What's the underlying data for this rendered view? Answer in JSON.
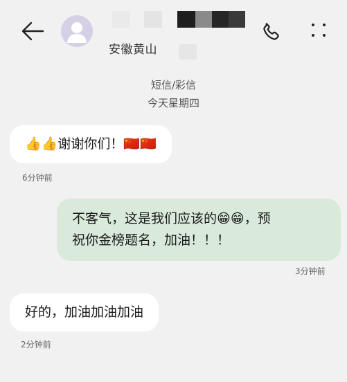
{
  "header": {
    "contact_name": "安徽黄山",
    "icons": {
      "back": "arrow-left-icon",
      "avatar": "person-avatar-icon",
      "call": "phone-icon",
      "more": "more-vertical-icon"
    }
  },
  "thread": {
    "channel": "短信/彩信",
    "day": "今天星期四"
  },
  "messages": [
    {
      "direction": "incoming",
      "emoji_before": "👍👍",
      "text": "谢谢你们！",
      "emoji_after": "🇨🇳🇨🇳",
      "time": "6分钟前"
    },
    {
      "direction": "outgoing",
      "line1_text": "不客气，这是我们应该的",
      "line1_emoji": "😁😁",
      "line1_tail": "，预",
      "line2_text": "祝你金榜题名，加油！！！",
      "time": "3分钟前"
    },
    {
      "direction": "incoming",
      "text": "好的，加油加油加油",
      "time": "2分钟前"
    }
  ],
  "colors": {
    "background": "#f1f1f1",
    "incoming_bubble": "#ffffff",
    "outgoing_bubble": "#d9eadb",
    "avatar": "#d6d0e6"
  }
}
